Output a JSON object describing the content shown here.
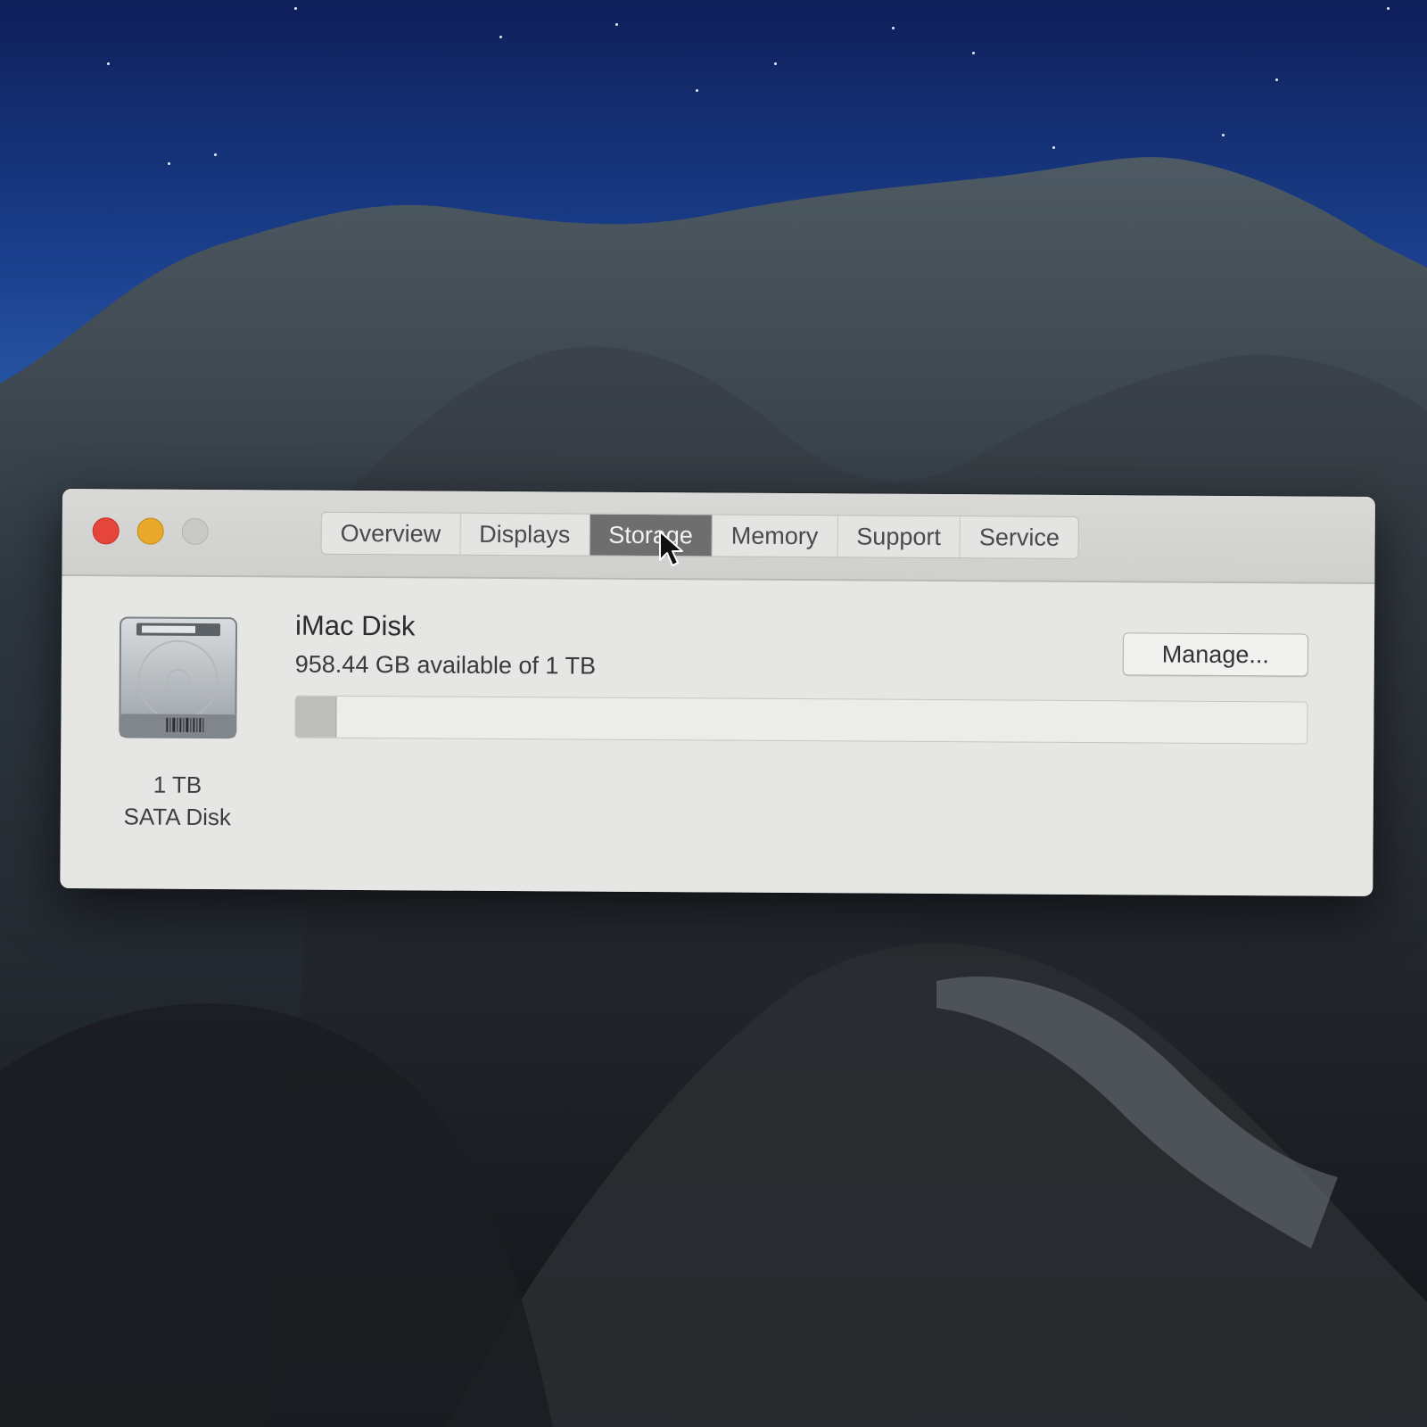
{
  "window": {
    "controls": {
      "close_icon": "close-icon",
      "minimize_icon": "minimize-icon",
      "zoom_icon": "zoom-icon"
    },
    "tabs": [
      {
        "label": "Overview",
        "selected": false
      },
      {
        "label": "Displays",
        "selected": false
      },
      {
        "label": "Storage",
        "selected": true
      },
      {
        "label": "Memory",
        "selected": false
      },
      {
        "label": "Support",
        "selected": false
      },
      {
        "label": "Service",
        "selected": false
      }
    ]
  },
  "storage": {
    "disk": {
      "icon": "hard-disk-icon",
      "size_label": "1 TB",
      "type_label": "SATA Disk",
      "name": "iMac Disk",
      "availability": "958.44 GB available of 1 TB",
      "used_fraction": 0.04
    },
    "manage_label": "Manage..."
  },
  "colors": {
    "close": "#e6453c",
    "minimize": "#e8a82a",
    "zoom": "#c9c9c7",
    "selected_tab": "#6e6e6e"
  }
}
